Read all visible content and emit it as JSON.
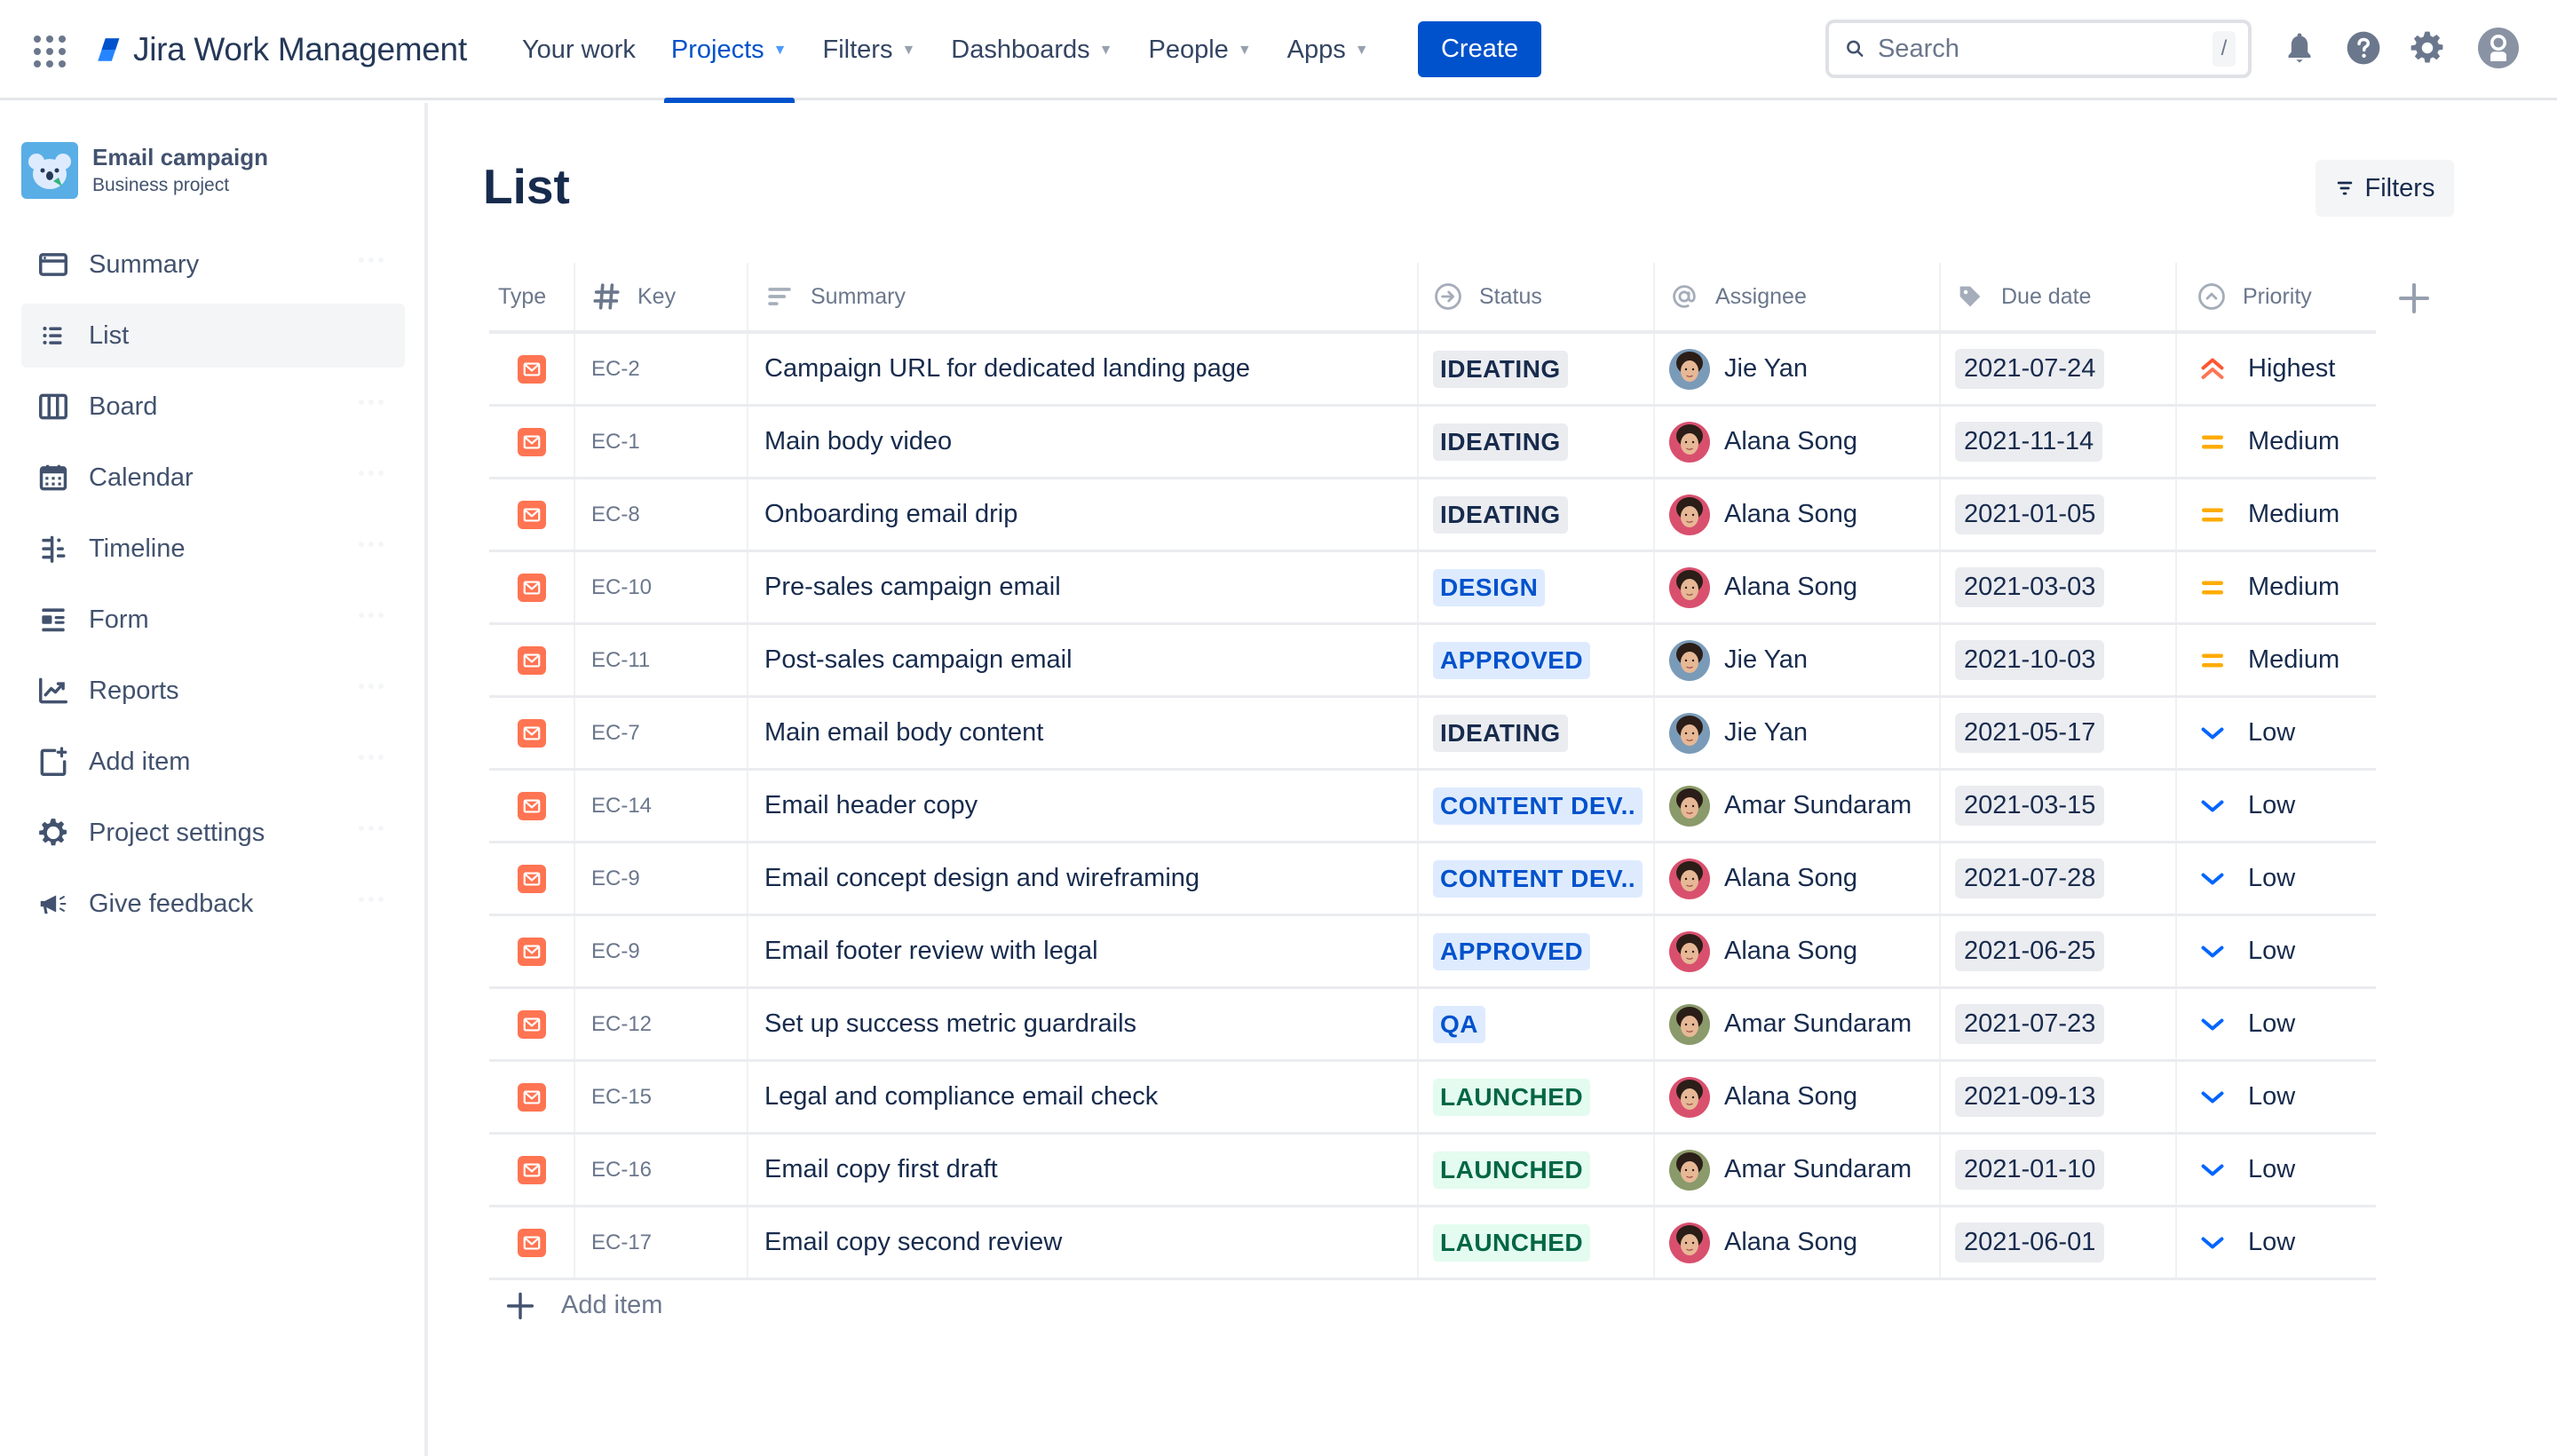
{
  "topbar": {
    "app_name": "Jira Work Management",
    "nav": [
      {
        "label": "Your work",
        "dropdown": false,
        "active": false
      },
      {
        "label": "Projects",
        "dropdown": true,
        "active": true
      },
      {
        "label": "Filters",
        "dropdown": true,
        "active": false
      },
      {
        "label": "Dashboards",
        "dropdown": true,
        "active": false
      },
      {
        "label": "People",
        "dropdown": true,
        "active": false
      },
      {
        "label": "Apps",
        "dropdown": true,
        "active": false
      }
    ],
    "create_label": "Create",
    "search_placeholder": "Search",
    "search_shortcut": "/",
    "icons": [
      "app-switcher-icon",
      "notifications-icon",
      "help-icon",
      "settings-icon",
      "profile-icon"
    ]
  },
  "sidebar": {
    "project_name": "Email campaign",
    "project_type": "Business project",
    "items": [
      {
        "label": "Summary",
        "icon": "summary-icon",
        "active": false
      },
      {
        "label": "List",
        "icon": "list-icon",
        "active": true
      },
      {
        "label": "Board",
        "icon": "board-icon",
        "active": false
      },
      {
        "label": "Calendar",
        "icon": "calendar-icon",
        "active": false
      },
      {
        "label": "Timeline",
        "icon": "timeline-icon",
        "active": false
      },
      {
        "label": "Form",
        "icon": "form-icon",
        "active": false
      },
      {
        "label": "Reports",
        "icon": "reports-icon",
        "active": false
      },
      {
        "label": "Add item",
        "icon": "add-item-icon",
        "active": false
      },
      {
        "label": "Project settings",
        "icon": "gear-icon",
        "active": false
      },
      {
        "label": "Give feedback",
        "icon": "megaphone-icon",
        "active": false
      }
    ]
  },
  "main": {
    "title": "List",
    "filters_label": "Filters",
    "columns": [
      {
        "label": "Type",
        "icon": ""
      },
      {
        "label": "Key",
        "icon": "hash-icon"
      },
      {
        "label": "Summary",
        "icon": "text-lines-icon"
      },
      {
        "label": "Status",
        "icon": "status-arrow-icon"
      },
      {
        "label": "Assignee",
        "icon": "at-icon"
      },
      {
        "label": "Due date",
        "icon": "tag-icon"
      },
      {
        "label": "Priority",
        "icon": "priority-icon"
      }
    ],
    "rows": [
      {
        "type": "email",
        "key": "EC-2",
        "summary": "Campaign URL for dedicated landing page",
        "status": "IDEATING",
        "assignee": "Jie Yan",
        "due": "2021-07-24",
        "priority": "Highest"
      },
      {
        "type": "email",
        "key": "EC-1",
        "summary": "Main body video",
        "status": "IDEATING",
        "assignee": "Alana Song",
        "due": "2021-11-14",
        "priority": "Medium"
      },
      {
        "type": "email",
        "key": "EC-8",
        "summary": "Onboarding email drip",
        "status": "IDEATING",
        "assignee": "Alana Song",
        "due": "2021-01-05",
        "priority": "Medium"
      },
      {
        "type": "email",
        "key": "EC-10",
        "summary": "Pre-sales campaign email",
        "status": "DESIGN",
        "assignee": "Alana Song",
        "due": "2021-03-03",
        "priority": "Medium"
      },
      {
        "type": "email",
        "key": "EC-11",
        "summary": "Post-sales campaign email",
        "status": "APPROVED",
        "assignee": "Jie Yan",
        "due": "2021-10-03",
        "priority": "Medium"
      },
      {
        "type": "email",
        "key": "EC-7",
        "summary": "Main email body content",
        "status": "IDEATING",
        "assignee": "Jie Yan",
        "due": "2021-05-17",
        "priority": "Low"
      },
      {
        "type": "email",
        "key": "EC-14",
        "summary": "Email header copy",
        "status": "CONTENT DEV..",
        "assignee": "Amar Sundaram",
        "due": "2021-03-15",
        "priority": "Low"
      },
      {
        "type": "email",
        "key": "EC-9",
        "summary": "Email concept design and wireframing",
        "status": "CONTENT DEV..",
        "assignee": "Alana Song",
        "due": "2021-07-28",
        "priority": "Low"
      },
      {
        "type": "email",
        "key": "EC-9",
        "summary": "Email footer review with legal",
        "status": "APPROVED",
        "assignee": "Alana Song",
        "due": "2021-06-25",
        "priority": "Low"
      },
      {
        "type": "email",
        "key": "EC-12",
        "summary": "Set up success metric guardrails",
        "status": "QA",
        "assignee": "Amar Sundaram",
        "due": "2021-07-23",
        "priority": "Low"
      },
      {
        "type": "email",
        "key": "EC-15",
        "summary": "Legal and compliance email check",
        "status": "LAUNCHED",
        "assignee": "Alana Song",
        "due": "2021-09-13",
        "priority": "Low"
      },
      {
        "type": "email",
        "key": "EC-16",
        "summary": "Email copy first draft",
        "status": "LAUNCHED",
        "assignee": "Amar Sundaram",
        "due": "2021-01-10",
        "priority": "Low"
      },
      {
        "type": "email",
        "key": "EC-17",
        "summary": "Email copy second review",
        "status": "LAUNCHED",
        "assignee": "Alana Song",
        "due": "2021-06-01",
        "priority": "Low"
      }
    ],
    "add_item_label": "Add item"
  },
  "colors": {
    "brand": "#0052cc",
    "type_email": "#ff7452",
    "status": {
      "IDEATING": {
        "bg": "#ebecf0",
        "fg": "#172b4d"
      },
      "DESIGN": {
        "bg": "#deebff",
        "fg": "#0052cc"
      },
      "APPROVED": {
        "bg": "#deebff",
        "fg": "#0052cc"
      },
      "CONTENT DEV..": {
        "bg": "#deebff",
        "fg": "#0052cc"
      },
      "QA": {
        "bg": "#deebff",
        "fg": "#0052cc"
      },
      "LAUNCHED": {
        "bg": "#e3fcef",
        "fg": "#006644"
      }
    },
    "priority": {
      "Highest": "#ff5630",
      "Medium": "#ffab00",
      "Low": "#0065ff"
    },
    "assignee": {
      "Jie Yan": "#7a9bb8",
      "Alana Song": "#d9506e",
      "Amar Sundaram": "#8a9a6a"
    }
  }
}
